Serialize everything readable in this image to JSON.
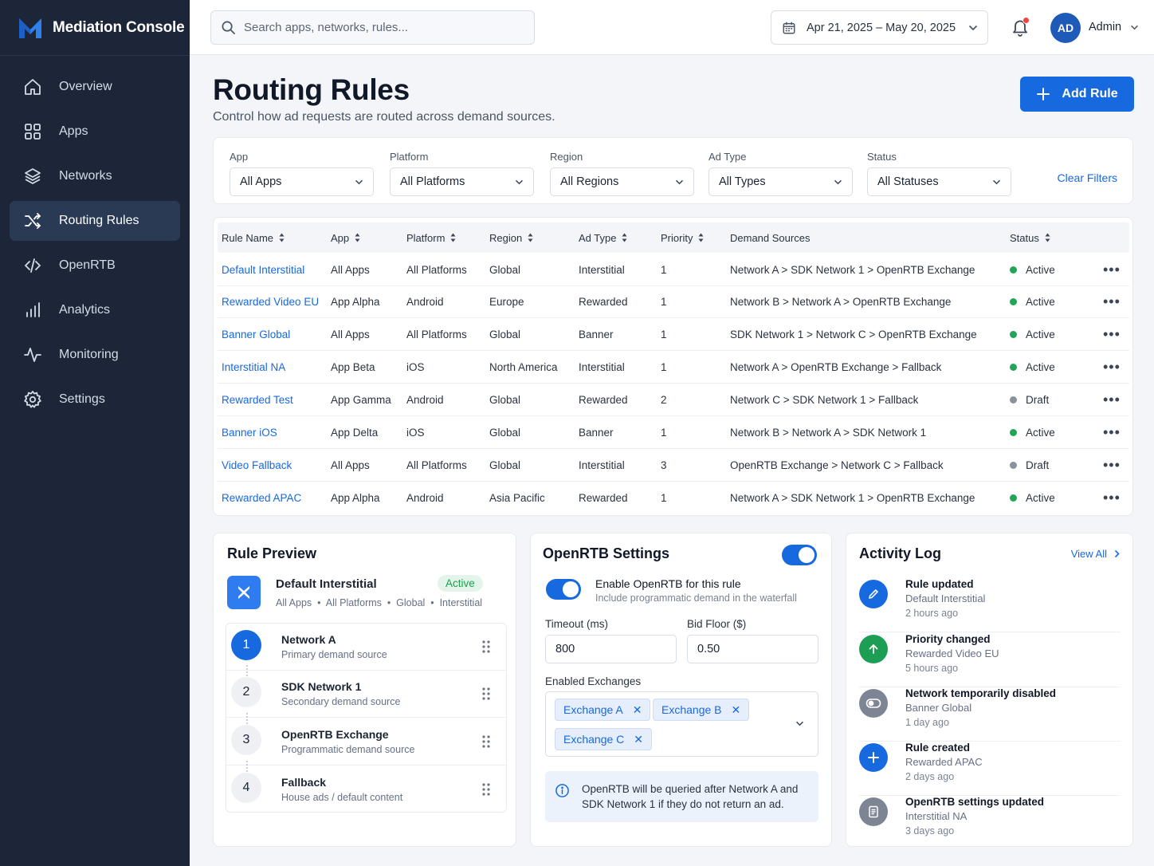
{
  "app": {
    "title": "Mediation Console"
  },
  "sidebar": {
    "items": [
      {
        "label": "Overview",
        "icon": "home-icon"
      },
      {
        "label": "Apps",
        "icon": "grid-icon"
      },
      {
        "label": "Networks",
        "icon": "layers-icon"
      },
      {
        "label": "Routing Rules",
        "icon": "shuffle-icon",
        "active": true
      },
      {
        "label": "OpenRTB",
        "icon": "code-icon"
      },
      {
        "label": "Analytics",
        "icon": "bar-chart-icon"
      },
      {
        "label": "Monitoring",
        "icon": "activity-icon"
      },
      {
        "label": "Settings",
        "icon": "gear-icon"
      }
    ]
  },
  "topbar": {
    "search_placeholder": "Search apps, networks, rules...",
    "date_range": "Apr 21, 2025 – May 20, 2025",
    "avatar_initials": "AD",
    "user_name": "Admin"
  },
  "page": {
    "title": "Routing Rules",
    "subtitle": "Control how ad requests are routed across demand sources.",
    "add_button": "Add Rule"
  },
  "filters": {
    "items": [
      {
        "label": "App",
        "value": "All Apps"
      },
      {
        "label": "Platform",
        "value": "All Platforms"
      },
      {
        "label": "Region",
        "value": "All Regions"
      },
      {
        "label": "Ad Type",
        "value": "All Types"
      },
      {
        "label": "Status",
        "value": "All Statuses"
      }
    ],
    "clear_label": "Clear Filters"
  },
  "table": {
    "headers": [
      "Rule Name",
      "App",
      "Platform",
      "Region",
      "Ad Type",
      "Priority",
      "Demand Sources",
      "Status"
    ],
    "rows": [
      {
        "name": "Default Interstitial",
        "app": "All Apps",
        "platform": "All Platforms",
        "region": "Global",
        "ad_type": "Interstitial",
        "priority": "1",
        "sources": "Network A > SDK Network 1 > OpenRTB Exchange",
        "status": "Active"
      },
      {
        "name": "Rewarded Video EU",
        "app": "App Alpha",
        "platform": "Android",
        "region": "Europe",
        "ad_type": "Rewarded",
        "priority": "1",
        "sources": "Network B > Network A > OpenRTB Exchange",
        "status": "Active"
      },
      {
        "name": "Banner Global",
        "app": "All Apps",
        "platform": "All Platforms",
        "region": "Global",
        "ad_type": "Banner",
        "priority": "1",
        "sources": "SDK Network 1 > Network C > OpenRTB Exchange",
        "status": "Active"
      },
      {
        "name": "Interstitial NA",
        "app": "App Beta",
        "platform": "iOS",
        "region": "North America",
        "ad_type": "Interstitial",
        "priority": "1",
        "sources": "Network A > OpenRTB Exchange > Fallback",
        "status": "Active"
      },
      {
        "name": "Rewarded Test",
        "app": "App Gamma",
        "platform": "Android",
        "region": "Global",
        "ad_type": "Rewarded",
        "priority": "2",
        "sources": "Network C > SDK Network 1 > Fallback",
        "status": "Draft"
      },
      {
        "name": "Banner iOS",
        "app": "App Delta",
        "platform": "iOS",
        "region": "Global",
        "ad_type": "Banner",
        "priority": "1",
        "sources": "Network B > Network A > SDK Network 1",
        "status": "Active"
      },
      {
        "name": "Video Fallback",
        "app": "All Apps",
        "platform": "All Platforms",
        "region": "Global",
        "ad_type": "Interstitial",
        "priority": "3",
        "sources": "OpenRTB Exchange > Network C > Fallback",
        "status": "Draft"
      },
      {
        "name": "Rewarded APAC",
        "app": "App Alpha",
        "platform": "Android",
        "region": "Asia Pacific",
        "ad_type": "Rewarded",
        "priority": "1",
        "sources": "Network A > SDK Network 1 > OpenRTB Exchange",
        "status": "Active"
      }
    ],
    "status_colors": {
      "Active": "#22a559",
      "Draft": "#8a919c"
    },
    "row_menu": "•••"
  },
  "rule_preview": {
    "title": "Rule Preview",
    "rule_name": "Default Interstitial",
    "status": "Active",
    "meta": "All Apps  •  All Platforms  •  Global  •  Interstitial",
    "steps": [
      {
        "num": "1",
        "name": "Network A",
        "desc": "Primary demand source"
      },
      {
        "num": "2",
        "name": "SDK Network 1",
        "desc": "Secondary demand source"
      },
      {
        "num": "3",
        "name": "OpenRTB Exchange",
        "desc": "Programmatic demand source"
      },
      {
        "num": "4",
        "name": "Fallback",
        "desc": "House ads / default content"
      }
    ]
  },
  "openrtb": {
    "title": "OpenRTB Settings",
    "enabled": true,
    "enable_label": "Enable OpenRTB for this rule",
    "enable_desc": "Include programmatic demand in the waterfall",
    "timeout_label": "Timeout (ms)",
    "timeout_value": "800",
    "bidfloor_label": "Bid Floor ($)",
    "bidfloor_value": "0.50",
    "exchanges_label": "Enabled Exchanges",
    "exchanges": [
      "Exchange A",
      "Exchange B",
      "Exchange C"
    ],
    "info": "OpenRTB will be queried after Network A and SDK Network 1 if they do not return an ad."
  },
  "activity": {
    "title": "Activity Log",
    "view_all": "View All",
    "items": [
      {
        "title": "Rule updated",
        "subject": "Default Interstitial",
        "time": "2 hours ago",
        "icon": "pencil-icon",
        "color": "#1769e0"
      },
      {
        "title": "Priority changed",
        "subject": "Rewarded Video EU",
        "time": "5 hours ago",
        "icon": "arrow-up-icon",
        "color": "#1e9e55"
      },
      {
        "title": "Network temporarily disabled",
        "subject": "Banner Global",
        "time": "1 day ago",
        "icon": "toggle-off-icon",
        "color": "#7d8594"
      },
      {
        "title": "Rule created",
        "subject": "Rewarded APAC",
        "time": "2 days ago",
        "icon": "plus-icon",
        "color": "#1769e0"
      },
      {
        "title": "OpenRTB settings updated",
        "subject": "Interstitial NA",
        "time": "3 days ago",
        "icon": "document-icon",
        "color": "#7d8594"
      }
    ]
  }
}
